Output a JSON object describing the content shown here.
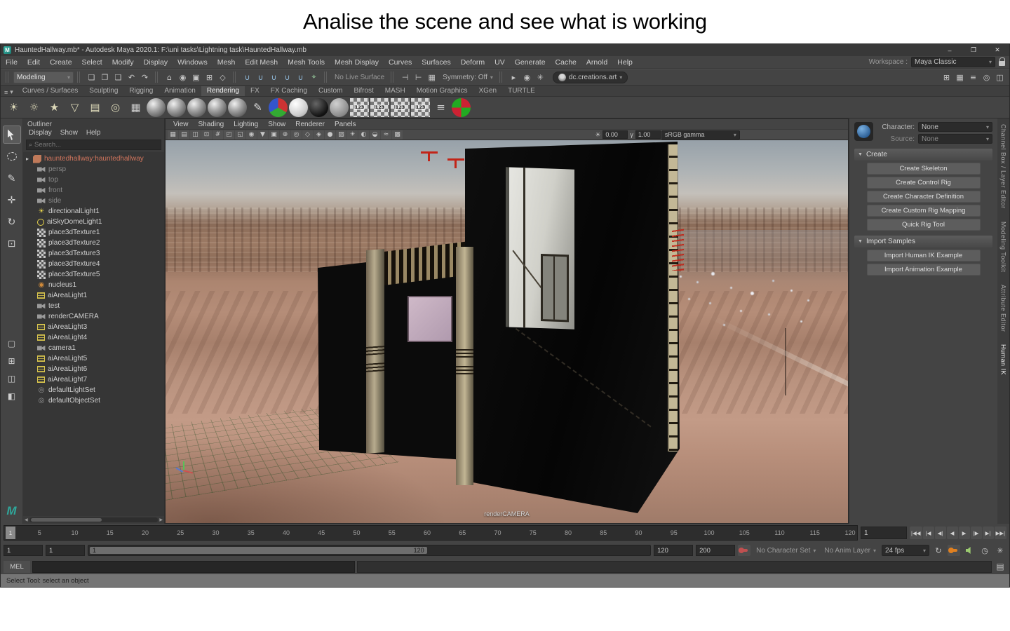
{
  "theme": {
    "bg": "#444444",
    "field": "#2b2b2b",
    "accent": "#5285a6",
    "trim": "#b8ac8e",
    "glass": "#e6e6e1",
    "pink": "#cfb9c8",
    "ref_text": "#d0745c"
  },
  "glyphs": {
    "dd_arrow": "▾",
    "tri_down": "▼",
    "expander": "▸",
    "search": "⌕",
    "hamburger": "≡",
    "left_arr": "◀",
    "right_arr": "▶",
    "exposure": "☀",
    "gamma": "γ",
    "loop": "↻",
    "clock": "◷",
    "gear": "✳",
    "script": "▤"
  },
  "banner": {
    "title": "Analise the scene and see what is working"
  },
  "window": {
    "app_badge": "M",
    "title": "HauntedHallway.mb* - Autodesk Maya 2020.1: F:\\uni tasks\\Lightning task\\HauntedHallway.mb",
    "controls": {
      "minimize": "–",
      "maximize": "❐",
      "close": "✕"
    }
  },
  "menubar": {
    "items": [
      "File",
      "Edit",
      "Create",
      "Select",
      "Modify",
      "Display",
      "Windows",
      "Mesh",
      "Edit Mesh",
      "Mesh Tools",
      "Mesh Display",
      "Curves",
      "Surfaces",
      "Deform",
      "UV",
      "Generate",
      "Cache",
      "Arnold",
      "Help"
    ],
    "workspace_label": "Workspace :",
    "workspace_value": "Maya Classic"
  },
  "statusline": {
    "mode": "Modeling",
    "live_surface": "No Live Surface",
    "symmetry": "Symmetry: Off",
    "account": "dc.creations.art",
    "file_icons": [
      {
        "n": "new-scene-icon",
        "g": "❏"
      },
      {
        "n": "open-scene-icon",
        "g": "❐"
      },
      {
        "n": "save-scene-icon",
        "g": "❑"
      },
      {
        "n": "undo-icon",
        "g": "↶"
      },
      {
        "n": "redo-icon",
        "g": "↷"
      }
    ],
    "mask_icons": [
      {
        "n": "select-by-hierarchy-icon",
        "g": "⌂"
      },
      {
        "n": "select-by-object-type-icon",
        "g": "◉"
      },
      {
        "n": "select-by-component-type-icon",
        "g": "▣"
      },
      {
        "n": "lock-selection-icon",
        "g": "⊞"
      },
      {
        "n": "highlight-selection-mode-icon",
        "g": "◇"
      }
    ],
    "snap_icons": [
      {
        "n": "snap-to-grid-icon",
        "g": "∪",
        "c": "#8fb8d8"
      },
      {
        "n": "snap-to-curve-icon",
        "g": "∪",
        "c": "#8fb8d8"
      },
      {
        "n": "snap-to-point-icon",
        "g": "∪",
        "c": "#8fb8d8"
      },
      {
        "n": "snap-to-projected-center-icon",
        "g": "∪",
        "c": "#8fb8d8"
      },
      {
        "n": "snap-to-view-plane-icon",
        "g": "∪",
        "c": "#8fb8d8"
      },
      {
        "n": "make-live-icon",
        "g": "⌖",
        "c": "#9ad0a0"
      }
    ],
    "history_icons": [
      {
        "n": "input-connections-icon",
        "g": "⊣"
      },
      {
        "n": "output-connections-icon",
        "g": "⊢"
      },
      {
        "n": "construction-history-icon",
        "g": "▦"
      }
    ],
    "render_icons": [
      {
        "n": "render-current-frame-icon",
        "g": "▸"
      },
      {
        "n": "ipr-render-icon",
        "g": "◉"
      },
      {
        "n": "render-settings-icon",
        "g": "✳"
      }
    ],
    "right_icons": [
      {
        "n": "sidebar-channelbox-icon",
        "g": "⊞"
      },
      {
        "n": "sidebar-attreditor-icon",
        "g": "▦"
      },
      {
        "n": "sidebar-toolsettings-icon",
        "g": "≡"
      },
      {
        "n": "sidebar-humanik-icon",
        "g": "◎"
      },
      {
        "n": "sidebar-modeling-toolkit-icon",
        "g": "◫"
      }
    ]
  },
  "shelf": {
    "active_tab": "Rendering",
    "tabs": [
      "Curves / Surfaces",
      "Sculpting",
      "Rigging",
      "Animation",
      "Rendering",
      "FX",
      "FX Caching",
      "Custom",
      "Bifrost",
      "MASH",
      "Motion Graphics",
      "XGen",
      "TURTLE"
    ],
    "icons": [
      {
        "n": "ambient-light-icon",
        "g": "☀",
        "c": "#dcd8b8"
      },
      {
        "n": "directional-light-icon",
        "g": "☼",
        "c": "#dcd8b8"
      },
      {
        "n": "point-light-icon",
        "g": "★",
        "c": "#dcd8b8"
      },
      {
        "n": "spot-light-icon",
        "g": "▽",
        "c": "#dcd8b8"
      },
      {
        "n": "area-light-icon",
        "g": "▤",
        "c": "#dcd8b8"
      },
      {
        "n": "volume-light-icon",
        "g": "◎",
        "c": "#dcd8b8"
      },
      {
        "n": "render-view-icon",
        "g": "▦",
        "c": "#c8c8c8"
      },
      {
        "n": "shading-ball-icon",
        "cls": "ball"
      },
      {
        "n": "blinn-ball-icon",
        "cls": "ball"
      },
      {
        "n": "lambert-ball-icon",
        "cls": "ball"
      },
      {
        "n": "phong-ball-icon",
        "cls": "ball"
      },
      {
        "n": "aistandard-ball-icon",
        "cls": "ball"
      },
      {
        "n": "hypershade-pen-icon",
        "g": "✎",
        "c": "#d8d8d8"
      },
      {
        "n": "rgb-ball-icon",
        "cls": "ball-rgb"
      },
      {
        "n": "white-ball-icon",
        "cls": "ball-white"
      },
      {
        "n": "black-ball-icon",
        "cls": "ball-black"
      },
      {
        "n": "gray-ball-icon",
        "cls": "ball-gray"
      },
      {
        "n": "uv-set-1-icon",
        "cls": "checker",
        "t": "123"
      },
      {
        "n": "uv-set-2-icon",
        "cls": "checker",
        "t": "123"
      },
      {
        "n": "uv-set-3-icon",
        "cls": "checker",
        "t": "123"
      },
      {
        "n": "uv-set-4-icon",
        "cls": "checker",
        "t": "123"
      },
      {
        "n": "light-editor-icon",
        "g": "≡",
        "c": "#c8c8c8"
      },
      {
        "n": "render-target-icon",
        "cls": "target"
      }
    ]
  },
  "toolbox": {
    "logo": "M",
    "tools": [
      {
        "n": "select-tool",
        "k": "arrow",
        "active": true
      },
      {
        "n": "lasso-select-tool",
        "k": "lasso"
      },
      {
        "n": "paint-select-tool",
        "g": "✎"
      },
      {
        "n": "move-tool",
        "g": "✛"
      },
      {
        "n": "rotate-tool",
        "g": "↻"
      },
      {
        "n": "scale-tool",
        "g": "⊡"
      }
    ],
    "layouts": [
      {
        "n": "layout-single-pane",
        "g": "▢"
      },
      {
        "n": "layout-four-pane",
        "g": "⊞"
      },
      {
        "n": "layout-two-pane-side",
        "g": "◫"
      },
      {
        "n": "layout-persp-outliner",
        "g": "◧"
      }
    ]
  },
  "outliner": {
    "title": "Outliner",
    "menus": [
      "Display",
      "Show",
      "Help"
    ],
    "search_placeholder": "Search...",
    "icon_glyphs": {
      "dirlight": "☀",
      "nucleus": "◉",
      "set": "◎"
    },
    "items": [
      {
        "label": "hauntedhallway:hauntedhallway",
        "icon": "mesh",
        "ref": true,
        "root": true
      },
      {
        "label": "persp",
        "icon": "cam",
        "dim": true
      },
      {
        "label": "top",
        "icon": "cam",
        "dim": true
      },
      {
        "label": "front",
        "icon": "cam",
        "dim": true
      },
      {
        "label": "side",
        "icon": "cam",
        "dim": true
      },
      {
        "label": "directionalLight1",
        "icon": "dirlight"
      },
      {
        "label": "aiSkyDomeLight1",
        "icon": "skydome"
      },
      {
        "label": "place3dTexture1",
        "icon": "tex"
      },
      {
        "label": "place3dTexture2",
        "icon": "tex"
      },
      {
        "label": "place3dTexture3",
        "icon": "tex"
      },
      {
        "label": "place3dTexture4",
        "icon": "tex"
      },
      {
        "label": "place3dTexture5",
        "icon": "tex"
      },
      {
        "label": "nucleus1",
        "icon": "nucleus"
      },
      {
        "label": "aiAreaLight1",
        "icon": "arealight"
      },
      {
        "label": "test",
        "icon": "cam"
      },
      {
        "label": "renderCAMERA",
        "icon": "cam"
      },
      {
        "label": "aiAreaLight3",
        "icon": "arealight"
      },
      {
        "label": "aiAreaLight4",
        "icon": "arealight"
      },
      {
        "label": "camera1",
        "icon": "cam"
      },
      {
        "label": "aiAreaLight5",
        "icon": "arealight"
      },
      {
        "label": "aiAreaLight6",
        "icon": "arealight"
      },
      {
        "label": "aiAreaLight7",
        "icon": "arealight"
      },
      {
        "label": "defaultLightSet",
        "icon": "set"
      },
      {
        "label": "defaultObjectSet",
        "icon": "set"
      }
    ]
  },
  "viewport": {
    "menus": [
      "View",
      "Shading",
      "Lighting",
      "Show",
      "Renderer",
      "Panels"
    ],
    "toolbar_icons": [
      {
        "n": "grid-toggle-icon",
        "g": "▦"
      },
      {
        "n": "film-gate-icon",
        "g": "▤"
      },
      {
        "n": "resolution-gate-icon",
        "g": "◫"
      },
      {
        "n": "gate-mask-icon",
        "g": "⊡"
      },
      {
        "n": "field-chart-icon",
        "g": "#"
      },
      {
        "n": "safe-action-icon",
        "g": "◰"
      },
      {
        "n": "safe-title-icon",
        "g": "◱"
      },
      {
        "n": "camera-attributes-icon",
        "g": "◉"
      },
      {
        "n": "bookmark-icon",
        "g": "▼"
      },
      {
        "n": "image-plane-icon",
        "g": "▣"
      },
      {
        "n": "pan-zoom-icon",
        "g": "⊕"
      },
      {
        "n": "isolate-select-icon",
        "g": "◎"
      },
      {
        "n": "xray-icon",
        "g": "◇"
      },
      {
        "n": "wireframe-on-shaded-icon",
        "g": "◈"
      },
      {
        "n": "default-material-icon",
        "g": "●"
      },
      {
        "n": "textured-icon",
        "g": "▨"
      },
      {
        "n": "use-all-lights-icon",
        "g": "☀"
      },
      {
        "n": "shadows-icon",
        "g": "◐"
      },
      {
        "n": "occlusion-icon",
        "g": "◒"
      },
      {
        "n": "motion-blur-icon",
        "g": "≈"
      },
      {
        "n": "multisample-icon",
        "g": "▩"
      }
    ],
    "exposure": "0.00",
    "gamma": "1.00",
    "colorspace": "sRGB gamma",
    "camera_label": "renderCAMERA"
  },
  "charpanel": {
    "character_label": "Character:",
    "character_value": "None",
    "source_label": "Source:",
    "source_value": "None",
    "sections": [
      {
        "title": "Create",
        "buttons": [
          "Create Skeleton",
          "Create Control Rig",
          "Create Character Definition",
          "Create Custom Rig Mapping",
          "Quick Rig Tool"
        ]
      },
      {
        "title": "Import Samples",
        "buttons": [
          "Import Human IK Example",
          "Import Animation Example"
        ]
      }
    ]
  },
  "side_tabs": [
    {
      "label": "Channel Box / Layer Editor"
    },
    {
      "label": "Modeling Toolkit"
    },
    {
      "label": "Attribute Editor"
    },
    {
      "label": "Human IK",
      "active": true
    }
  ],
  "timeline": {
    "start": 1,
    "end": 120,
    "current": "1",
    "field": "1",
    "labels": [
      5,
      10,
      15,
      20,
      25,
      30,
      35,
      40,
      45,
      50,
      55,
      60,
      65,
      70,
      75,
      80,
      85,
      90,
      95,
      100,
      105,
      110,
      115,
      120
    ]
  },
  "transport": [
    {
      "n": "go-to-start-button",
      "g": "|◀◀"
    },
    {
      "n": "step-back-frame-button",
      "g": "|◀"
    },
    {
      "n": "step-back-key-button",
      "g": "◀|"
    },
    {
      "n": "play-backwards-button",
      "g": "◀"
    },
    {
      "n": "play-forwards-button",
      "g": "▶"
    },
    {
      "n": "step-forward-key-button",
      "g": "|▶"
    },
    {
      "n": "step-forward-frame-button",
      "g": "▶|"
    },
    {
      "n": "go-to-end-button",
      "g": "▶▶|"
    }
  ],
  "range": {
    "anim_start": "1",
    "play_start": "1",
    "handle_start": "1",
    "handle_end": "120",
    "play_end": "120",
    "anim_end": "200",
    "character_set": "No Character Set",
    "anim_layer": "No Anim Layer",
    "fps": "24 fps"
  },
  "cmd": {
    "label": "MEL"
  },
  "help": {
    "text": "Select Tool: select an object"
  }
}
